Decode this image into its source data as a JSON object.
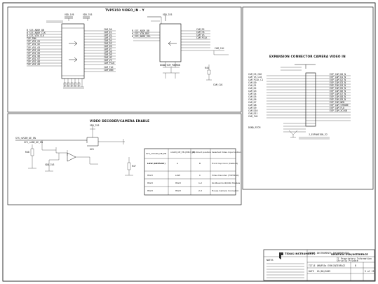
{
  "sheets": {
    "tvp5150": {
      "title": "TVP5150 VIDEO_IN - Y"
    },
    "expansion": {
      "title": "EXPANSION CONNECTOR CAMERA VIDEO IN"
    },
    "decoder": {
      "title": "VIDEO DECODER/CAMERA ENABLE"
    }
  },
  "enable_table": {
    "headers": [
      "SYS_nVCAM_OE_EN",
      "nCAM_OE_EN (MPU_CE)",
      "JP1 Shunt position",
      "Selected Video Input option"
    ],
    "rows": [
      [
        "LOW (DEFAULT)",
        "A",
        "B",
        "Front Cap Conn (Default)"
      ],
      [
        "HIGH",
        "LOW",
        "C",
        "Video Decoder (TVP5150)"
      ],
      [
        "HIGH",
        "HIGH",
        "1-2",
        "On-Board LCD/CRC Module"
      ],
      [
        "HIGH",
        "HIGH",
        "2-3",
        "House Camera Connector"
      ]
    ]
  },
  "title_block": {
    "company": "TEXAS INSTRUMENTS",
    "company_sub": "TEXAS INSTRUMENTS INCORPORATED",
    "drawing_title": "OMAP35x EVM/INTERFACE",
    "ti_proprietary": "TI Proprietary Information",
    "strictly_private": "Strictly Private",
    "title_label": "TITLE",
    "title_value": "OMAP35x EVM/INTERFACE",
    "rev": "B",
    "sheet": "5 of 13",
    "date_label": "DATE",
    "date_value": "01/06/2009",
    "notes_label": "NOTES"
  },
  "icons": {
    "logo": "ti-logo-icon"
  }
}
